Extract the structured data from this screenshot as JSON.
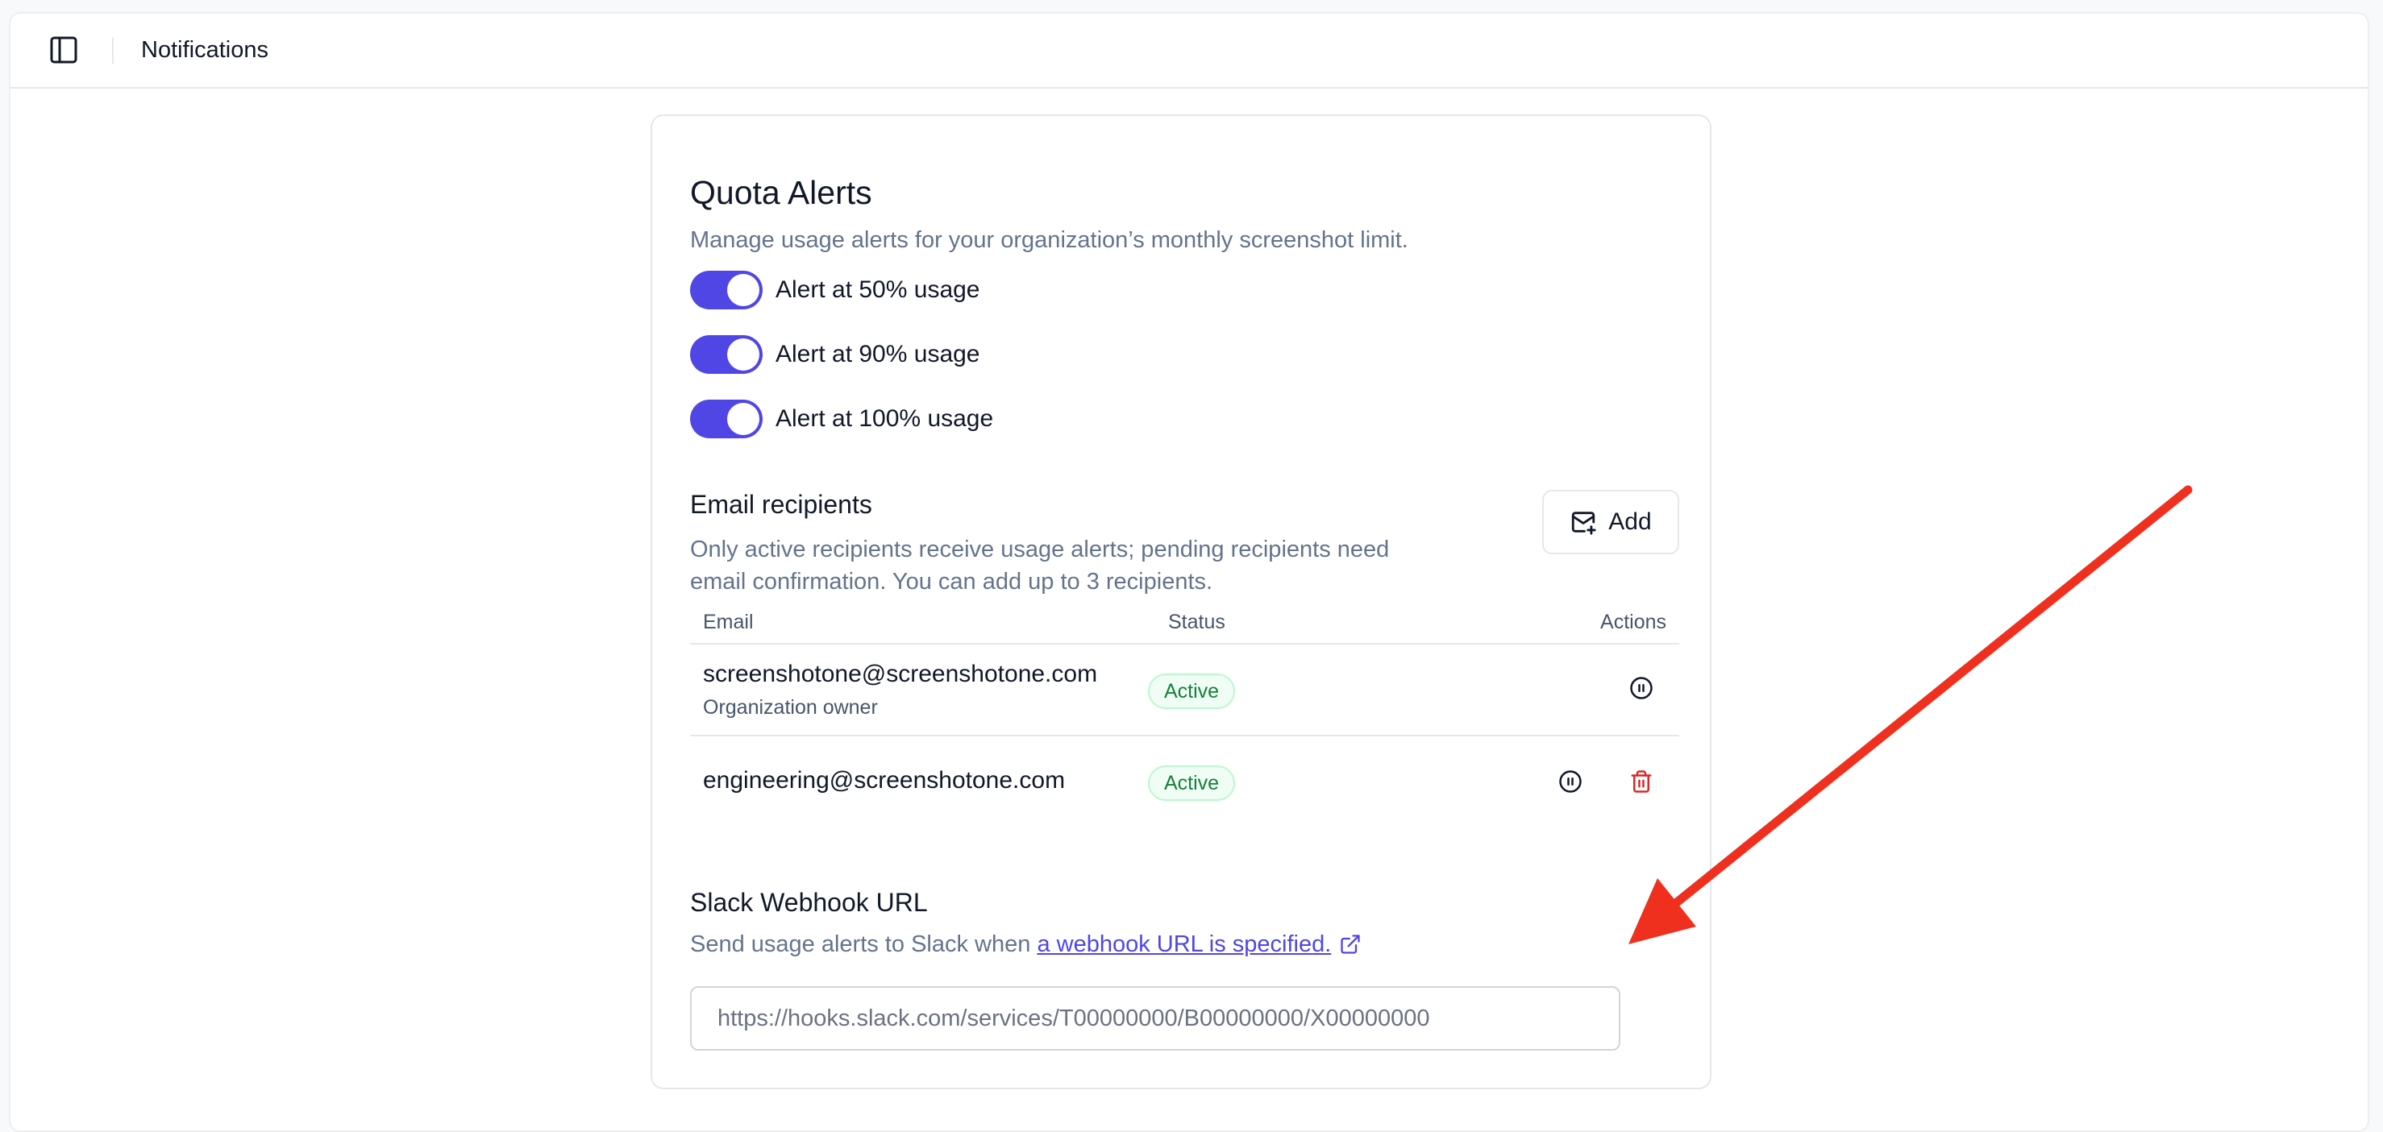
{
  "header": {
    "title": "Notifications",
    "sidebar_toggle_icon": "sidebar-panel-icon"
  },
  "quota": {
    "title": "Quota Alerts",
    "description": "Manage usage alerts for your organization’s monthly screenshot limit.",
    "toggles": [
      {
        "label": "Alert at 50% usage",
        "enabled": true
      },
      {
        "label": "Alert at 90% usage",
        "enabled": true
      },
      {
        "label": "Alert at 100% usage",
        "enabled": true
      }
    ]
  },
  "recipients": {
    "title": "Email recipients",
    "description_line1": "Only active recipients receive usage alerts; pending recipients need",
    "description_line2": "email confirmation. You can add up to 3 recipients.",
    "add_label": "Add",
    "add_icon": "mail-plus-icon",
    "columns": {
      "email": "Email",
      "status": "Status",
      "actions": "Actions"
    },
    "rows": [
      {
        "email": "screenshotone@screenshotone.com",
        "subtitle": "Organization owner",
        "status": "Active",
        "actions": [
          "pause-icon"
        ]
      },
      {
        "email": "engineering@screenshotone.com",
        "subtitle": "",
        "status": "Active",
        "actions": [
          "pause-icon",
          "trash-icon"
        ]
      }
    ]
  },
  "slack": {
    "title": "Slack Webhook URL",
    "description_prefix": "Send usage alerts to Slack when ",
    "link_text": "a webhook URL is specified.",
    "link_icon": "external-link-icon",
    "placeholder": "https://hooks.slack.com/services/T00000000/B00000000/X00000000",
    "value": ""
  },
  "colors": {
    "accent": "#4f46e5",
    "success_text": "#15803d",
    "danger": "#dc2626",
    "annotation_arrow": "#f0301f"
  },
  "annotation": {
    "arrow_icon": "red-arrow-annotation"
  }
}
